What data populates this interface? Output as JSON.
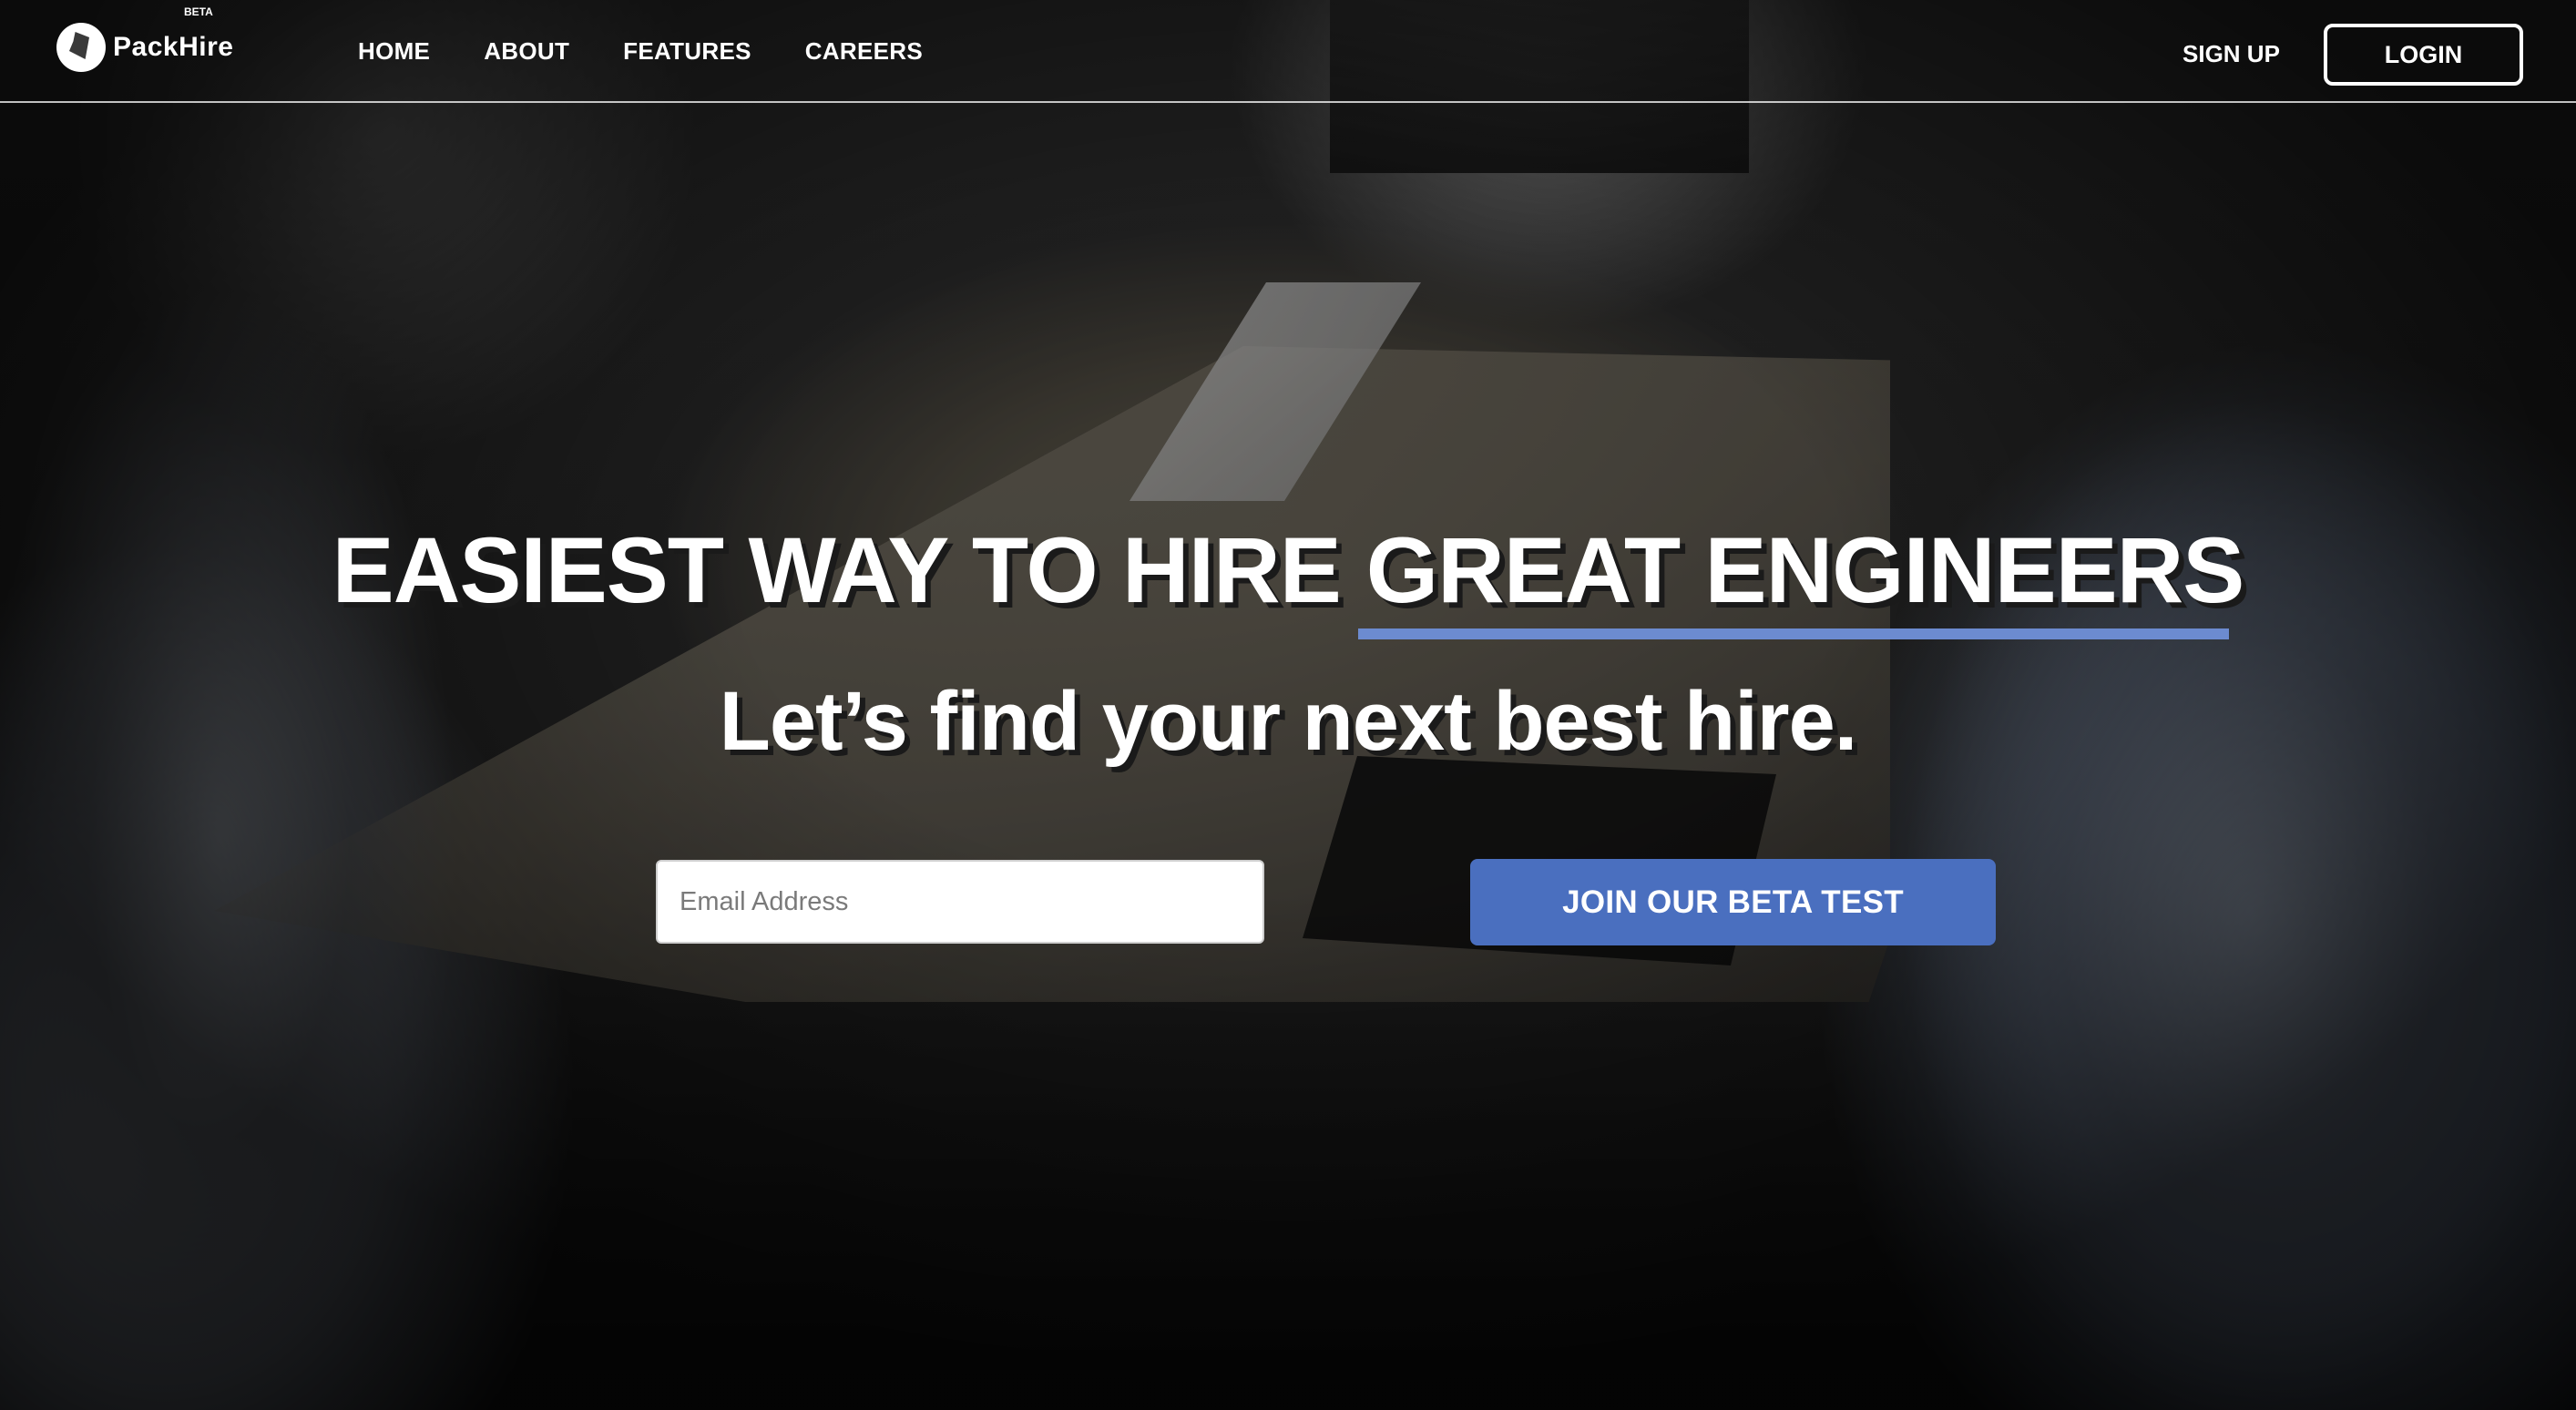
{
  "brand": {
    "name": "PackHire",
    "badge": "BETA"
  },
  "nav": {
    "links": [
      "HOME",
      "ABOUT",
      "FEATURES",
      "CAREERS"
    ],
    "signup_label": "SIGN UP",
    "login_label": "LOGIN"
  },
  "hero": {
    "headline_prefix": "EASIEST WAY TO HIRE",
    "headline_accent": "GREAT ENGINEERS",
    "subheadline": "Let’s find your next best hire.",
    "email_placeholder": "Email Address",
    "cta_label": "JOIN OUR BETA TEST"
  },
  "colors": {
    "accent": "#4a6fbf",
    "underline": "#6c8bd0",
    "text": "#ffffff"
  }
}
